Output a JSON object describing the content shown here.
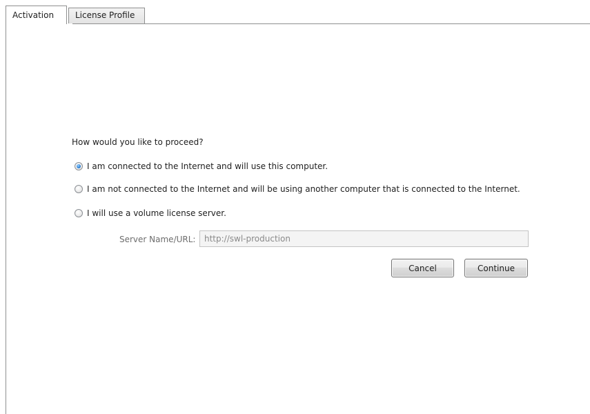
{
  "tabs": [
    {
      "label": "Activation",
      "active": true
    },
    {
      "label": "License Profile",
      "active": false
    }
  ],
  "activation": {
    "question": "How would you like to proceed?",
    "options": [
      {
        "label": "I am connected to the Internet and will use this computer.",
        "selected": true
      },
      {
        "label": "I am not connected to the Internet and will be using another computer that is connected to the Internet.",
        "selected": false
      },
      {
        "label": "I will use a volume license server.",
        "selected": false
      }
    ],
    "server": {
      "label": "Server Name/URL:",
      "value": "http://swl-production",
      "enabled": false
    },
    "buttons": {
      "cancel": "Cancel",
      "continue": "Continue"
    }
  },
  "colors": {
    "border": "#8e8f8f",
    "radio_selected": "#2a7fd4",
    "disabled_text": "#6d6d6d"
  }
}
